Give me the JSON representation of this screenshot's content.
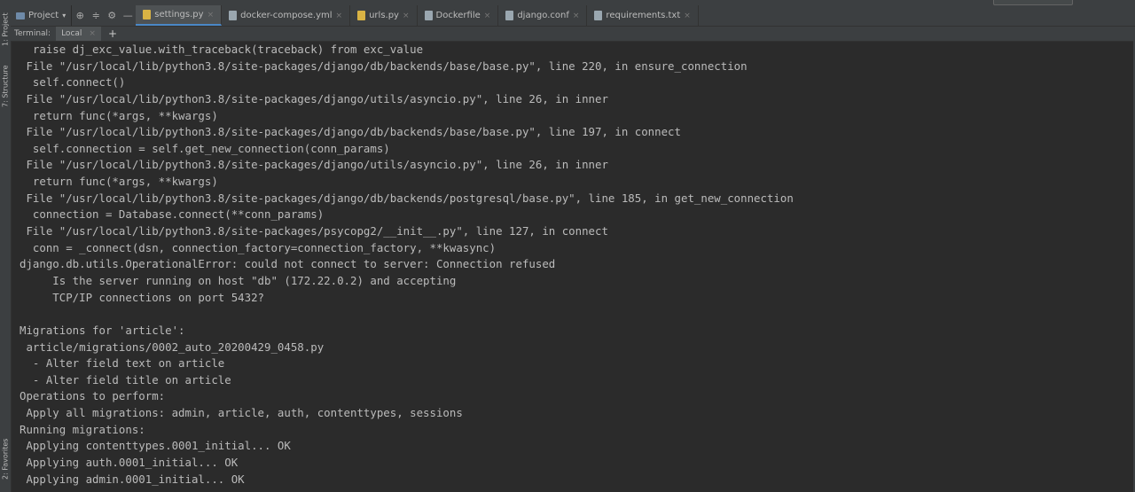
{
  "tabs": {
    "project_label": "Project",
    "files": [
      {
        "label": "settings.py",
        "active": true,
        "color": "#d9b344"
      },
      {
        "label": "docker-compose.yml",
        "active": false,
        "color": "#9aa7b0"
      },
      {
        "label": "urls.py",
        "active": false,
        "color": "#d9b344"
      },
      {
        "label": "Dockerfile",
        "active": false,
        "color": "#9aa7b0"
      },
      {
        "label": "django.conf",
        "active": false,
        "color": "#9aa7b0"
      },
      {
        "label": "requirements.txt",
        "active": false,
        "color": "#9aa7b0"
      }
    ]
  },
  "side": {
    "project": "1: Project",
    "structure": "7: Structure",
    "favorites": "2: Favorites"
  },
  "terminal": {
    "label": "Terminal:",
    "tab": "Local",
    "lines": [
      "  raise dj_exc_value.with_traceback(traceback) from exc_value",
      " File \"/usr/local/lib/python3.8/site-packages/django/db/backends/base/base.py\", line 220, in ensure_connection",
      "  self.connect()",
      " File \"/usr/local/lib/python3.8/site-packages/django/utils/asyncio.py\", line 26, in inner",
      "  return func(*args, **kwargs)",
      " File \"/usr/local/lib/python3.8/site-packages/django/db/backends/base/base.py\", line 197, in connect",
      "  self.connection = self.get_new_connection(conn_params)",
      " File \"/usr/local/lib/python3.8/site-packages/django/utils/asyncio.py\", line 26, in inner",
      "  return func(*args, **kwargs)",
      " File \"/usr/local/lib/python3.8/site-packages/django/db/backends/postgresql/base.py\", line 185, in get_new_connection",
      "  connection = Database.connect(**conn_params)",
      " File \"/usr/local/lib/python3.8/site-packages/psycopg2/__init__.py\", line 127, in connect",
      "  conn = _connect(dsn, connection_factory=connection_factory, **kwasync)",
      "django.db.utils.OperationalError: could not connect to server: Connection refused",
      "     Is the server running on host \"db\" (172.22.0.2) and accepting",
      "     TCP/IP connections on port 5432?",
      "",
      "Migrations for 'article':",
      " article/migrations/0002_auto_20200429_0458.py",
      "  - Alter field text on article",
      "  - Alter field title on article",
      "Operations to perform:",
      " Apply all migrations: admin, article, auth, contenttypes, sessions",
      "Running migrations:",
      " Applying contenttypes.0001_initial... OK",
      " Applying auth.0001_initial... OK",
      " Applying admin.0001_initial... OK"
    ]
  }
}
